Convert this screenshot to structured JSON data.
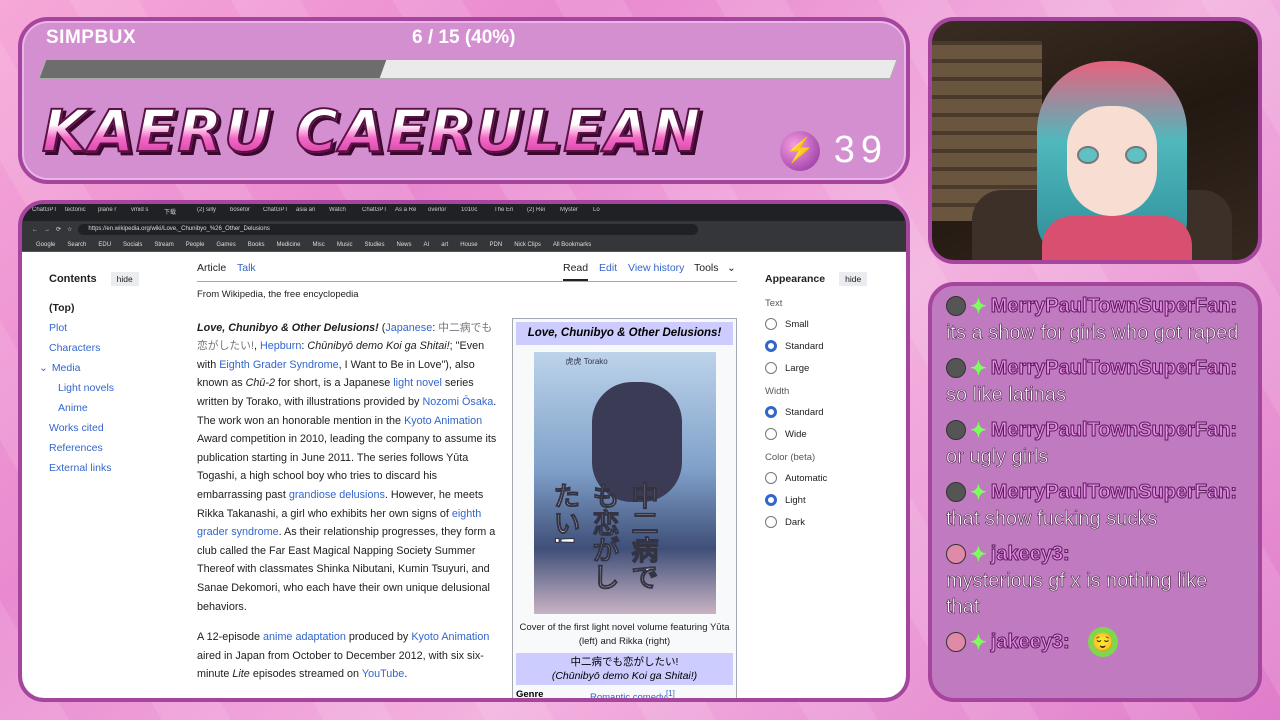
{
  "overlay": {
    "simpbux_label": "SIMPBUX",
    "progress_text": "6 / 15 (40%)",
    "progress_fraction": 0.4,
    "channel_title": "KAERU CAERULEAN",
    "counter_value": "39"
  },
  "chat": {
    "messages": [
      {
        "user": "MerryPaulTownSuperFan:",
        "text": "its a show for girls who got raped",
        "avatar": "dark"
      },
      {
        "user": "MerryPaulTownSuperFan:",
        "text": "so like latinas",
        "avatar": "dark"
      },
      {
        "user": "MerryPaulTownSuperFan:",
        "text": "or ugly girls",
        "avatar": "dark"
      },
      {
        "user": "MerryPaulTownSuperFan:",
        "text": "that show fucking sucks",
        "avatar": "dark"
      },
      {
        "user": "jakeey3:",
        "text": "mysterious gf x is nothing like that",
        "avatar": "pink"
      },
      {
        "user": "jakeey3:",
        "text": "",
        "avatar": "pink",
        "emote": "face-emote"
      }
    ]
  },
  "browser": {
    "tabs": [
      "ChatGPT",
      "tectonic",
      "plane r",
      "vmid s",
      "下载",
      "(2) silly",
      "bosefor",
      "ChatGPT",
      "asia an",
      "Watch",
      "ChatGPT",
      "As a Re",
      "overlor",
      "1010c",
      "The En",
      "(2) Rei",
      "Myster",
      "Lo"
    ],
    "url": "https://en.wikipedia.org/wiki/Love,_Chunibyo_%26_Other_Delusions",
    "bookmarks": [
      "Google",
      "Search",
      "EDU",
      "Socials",
      "Stream",
      "People",
      "Games",
      "Books",
      "Medicine",
      "Misc",
      "Music",
      "Studies",
      "News",
      "AI",
      "art",
      "House",
      "PDN",
      "Nick Clips",
      "All Bookmarks"
    ]
  },
  "wiki": {
    "toc": {
      "title": "Contents",
      "hide": "hide",
      "items": [
        "(Top)",
        "Plot",
        "Characters",
        "Media",
        "Light novels",
        "Anime",
        "Works cited",
        "References",
        "External links"
      ]
    },
    "tabs": {
      "article": "Article",
      "talk": "Talk",
      "read": "Read",
      "edit": "Edit",
      "history": "View history",
      "tools": "Tools"
    },
    "from": "From Wikipedia, the free encyclopedia",
    "infobox": {
      "title": "Love, Chunibyo & Other Delusions!",
      "cover_text": "中二病でも恋がしたい!",
      "cover_author": "虎虎 Torako",
      "caption": "Cover of the first light novel volume featuring Yūta (left) and Rikka (right)",
      "native": "中二病でも恋がしたい!",
      "romaji": "(Chūnibyō demo Koi ga Shitai!)",
      "genre_label": "Genre",
      "genre_value": "Romantic comedy",
      "genre_ref": "[1]"
    },
    "appearance": {
      "title": "Appearance",
      "hide": "hide",
      "text_label": "Text",
      "text_options": [
        "Small",
        "Standard",
        "Large"
      ],
      "width_label": "Width",
      "width_options": [
        "Standard",
        "Wide"
      ],
      "color_label": "Color (beta)",
      "color_options": [
        "Automatic",
        "Light",
        "Dark"
      ]
    }
  }
}
